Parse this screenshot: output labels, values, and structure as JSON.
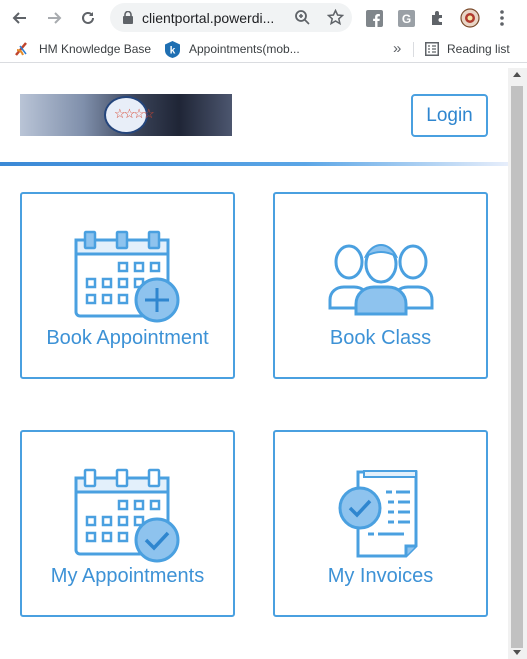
{
  "browser": {
    "url": "clientportal.powerdi...",
    "bookmarks": [
      "HM Knowledge Base",
      "Appointments(mob..."
    ],
    "reading_list": "Reading list",
    "overflow": "»"
  },
  "page": {
    "login_label": "Login",
    "tiles": [
      {
        "label": "Book Appointment",
        "icon": "calendar-plus-icon"
      },
      {
        "label": "Book Class",
        "icon": "group-icon"
      },
      {
        "label": "My Appointments",
        "icon": "calendar-check-icon"
      },
      {
        "label": "My Invoices",
        "icon": "invoice-icon"
      }
    ]
  },
  "colors": {
    "accent": "#4aa0e0",
    "label": "#3d92d6",
    "icon_fill": "#bcd9f5"
  }
}
